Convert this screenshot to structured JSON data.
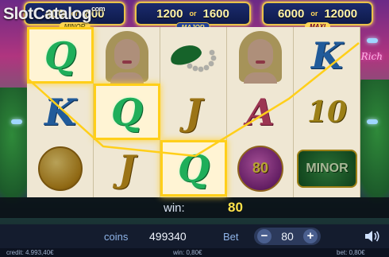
{
  "watermark": {
    "text": "SlotCatalog",
    "suffix": "com"
  },
  "jackpots": [
    {
      "low": "400",
      "or": "or",
      "high": "800",
      "tag": "MINOR"
    },
    {
      "low": "1200",
      "or": "or",
      "high": "1600",
      "tag": "MAJOR"
    },
    {
      "low": "6000",
      "or": "or",
      "high": "12000",
      "tag": "MAXI"
    }
  ],
  "reels": [
    [
      {
        "symbol": "Q",
        "kind": "letter",
        "highlight": true
      },
      {
        "symbol": "K",
        "kind": "letter"
      },
      {
        "symbol": "coin",
        "kind": "coin"
      }
    ],
    [
      {
        "symbol": "woman",
        "kind": "portrait"
      },
      {
        "symbol": "Q",
        "kind": "letter",
        "highlight": true
      },
      {
        "symbol": "J",
        "kind": "letter"
      }
    ],
    [
      {
        "symbol": "pearls",
        "kind": "pearls"
      },
      {
        "symbol": "J",
        "kind": "letter"
      },
      {
        "symbol": "Q",
        "kind": "letter",
        "highlight": true
      }
    ],
    [
      {
        "symbol": "woman",
        "kind": "portrait"
      },
      {
        "symbol": "A",
        "kind": "letter"
      },
      {
        "symbol": "80",
        "kind": "orb"
      }
    ],
    [
      {
        "symbol": "K",
        "kind": "letter"
      },
      {
        "symbol": "10",
        "kind": "letter"
      },
      {
        "symbol": "MINOR",
        "kind": "minor"
      }
    ]
  ],
  "win": {
    "label": "win:",
    "value": "80"
  },
  "controls": {
    "coins_label": "coins",
    "coins_value": "499340",
    "bet_label": "Bet",
    "bet_value": "80",
    "minus": "−",
    "plus": "+"
  },
  "status": {
    "credit": "credit: 4.993,40€",
    "win": "win: 0,80€",
    "bet": "bet: 0,80€"
  },
  "side_logo": "Rich",
  "colors": {
    "highlight": "#ffcf1a",
    "win_value": "#ffe24a",
    "panel": "#141c2e"
  }
}
